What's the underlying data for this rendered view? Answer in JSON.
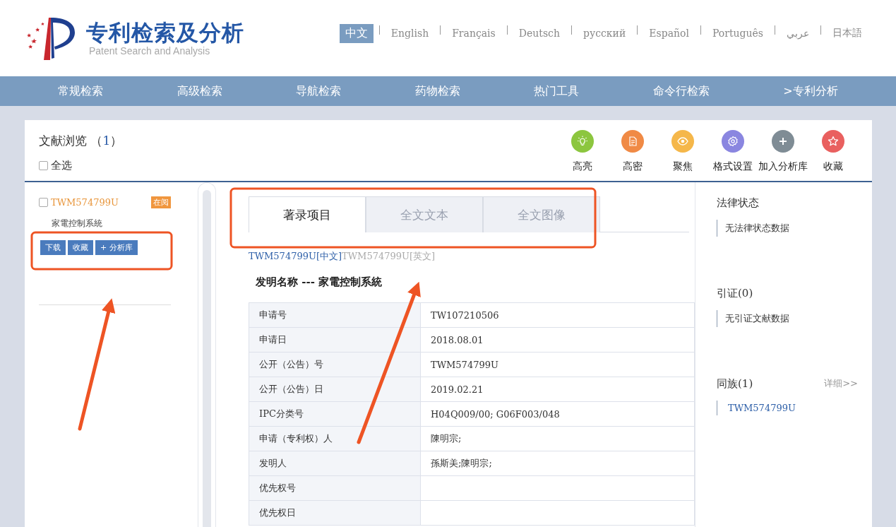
{
  "header": {
    "logo_title": "专利检索及分析",
    "logo_subtitle": "Patent Search and Analysis",
    "languages": [
      {
        "label": "中文",
        "selected": true
      },
      {
        "label": "English",
        "selected": false
      },
      {
        "label": "Français",
        "selected": false
      },
      {
        "label": "Deutsch",
        "selected": false
      },
      {
        "label": "русский",
        "selected": false
      },
      {
        "label": "Español",
        "selected": false
      },
      {
        "label": "Português",
        "selected": false
      },
      {
        "label": "عربي",
        "selected": false
      },
      {
        "label": "日本語",
        "selected": false
      }
    ]
  },
  "nav": [
    "常规检索",
    "高级检索",
    "导航检索",
    "药物检索",
    "热门工具",
    "命令行检索",
    ">专利分析"
  ],
  "doc_browser": {
    "title": "文献浏览",
    "count": "1",
    "count_brackets": [
      "（",
      "）"
    ],
    "select_all": {
      "label": "全选",
      "checked": false
    }
  },
  "tools": [
    {
      "label": "高亮",
      "kind": "highlight"
    },
    {
      "label": "高密",
      "kind": "density"
    },
    {
      "label": "聚焦",
      "kind": "focus"
    },
    {
      "label": "格式设置",
      "kind": "settings"
    },
    {
      "label": "加入分析库",
      "kind": "add"
    },
    {
      "label": "收藏",
      "kind": "favorite"
    }
  ],
  "results": [
    {
      "id": "TWM574799U",
      "checked": false,
      "badge": "在阅",
      "title": "家電控制系統",
      "buttons": [
        "下载",
        "收藏",
        "+ 分析库"
      ]
    }
  ],
  "tabs": [
    {
      "label": "著录项目",
      "selected": true
    },
    {
      "label": "全文文本",
      "selected": false
    },
    {
      "label": "全文图像",
      "selected": false
    }
  ],
  "doc_links": [
    {
      "label": "TWM574799U[中文]",
      "selected": true
    },
    {
      "label": "TWM574799U[英文]",
      "selected": false
    }
  ],
  "invention_name": {
    "label": "发明名称 ---",
    "value": "家電控制系統"
  },
  "fields": [
    {
      "label": "申请号",
      "value": "TW107210506"
    },
    {
      "label": "申请日",
      "value": "2018.08.01"
    },
    {
      "label": "公开（公告）号",
      "value": "TWM574799U"
    },
    {
      "label": "公开（公告）日",
      "value": "2019.02.21"
    },
    {
      "label": "IPC分类号",
      "value": "H04Q009/00; G06F003/048"
    },
    {
      "label": "申请（专利权）人",
      "value": "陳明宗;"
    },
    {
      "label": "发明人",
      "value": "孫斯美;陳明宗;"
    },
    {
      "label": "优先权号"
    },
    {
      "label": "优先权日"
    }
  ],
  "side": {
    "legal_status": {
      "title": "法律状态",
      "text": "无法律状态数据"
    },
    "citations": {
      "title": "引证(0)",
      "text": "无引证文献数据"
    },
    "family": {
      "title": "同族(1)",
      "more": "详细>>",
      "items": [
        "TWM574799U"
      ]
    }
  }
}
